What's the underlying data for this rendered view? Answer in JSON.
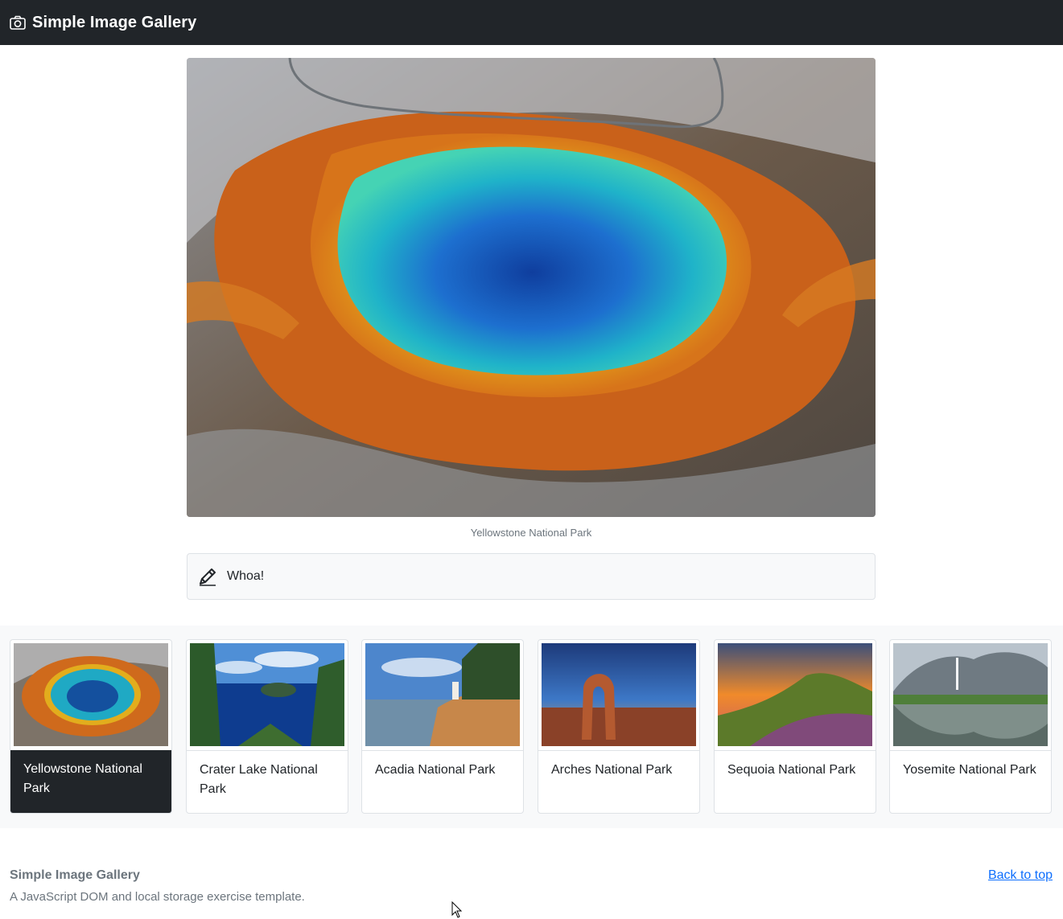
{
  "navbar": {
    "brand_icon": "camera-icon",
    "brand": "Simple Image Gallery"
  },
  "main": {
    "image_name": "Yellowstone National Park",
    "caption": "Yellowstone National Park"
  },
  "comment": {
    "icon": "pencil-icon",
    "text": "Whoa!"
  },
  "gallery": {
    "items": [
      {
        "label": "Yellowstone National Park",
        "active": true
      },
      {
        "label": "Crater Lake National Park",
        "active": false
      },
      {
        "label": "Acadia National Park",
        "active": false
      },
      {
        "label": "Arches National Park",
        "active": false
      },
      {
        "label": "Sequoia National Park",
        "active": false
      },
      {
        "label": "Yosemite National Park",
        "active": false
      }
    ]
  },
  "footer": {
    "title": "Simple Image Gallery",
    "subtitle": "A JavaScript DOM and local storage exercise template.",
    "back_to_top": "Back to top"
  },
  "colors": {
    "navbar_bg": "#212529",
    "active_card_bg": "#212529",
    "link": "#0d6efd"
  }
}
